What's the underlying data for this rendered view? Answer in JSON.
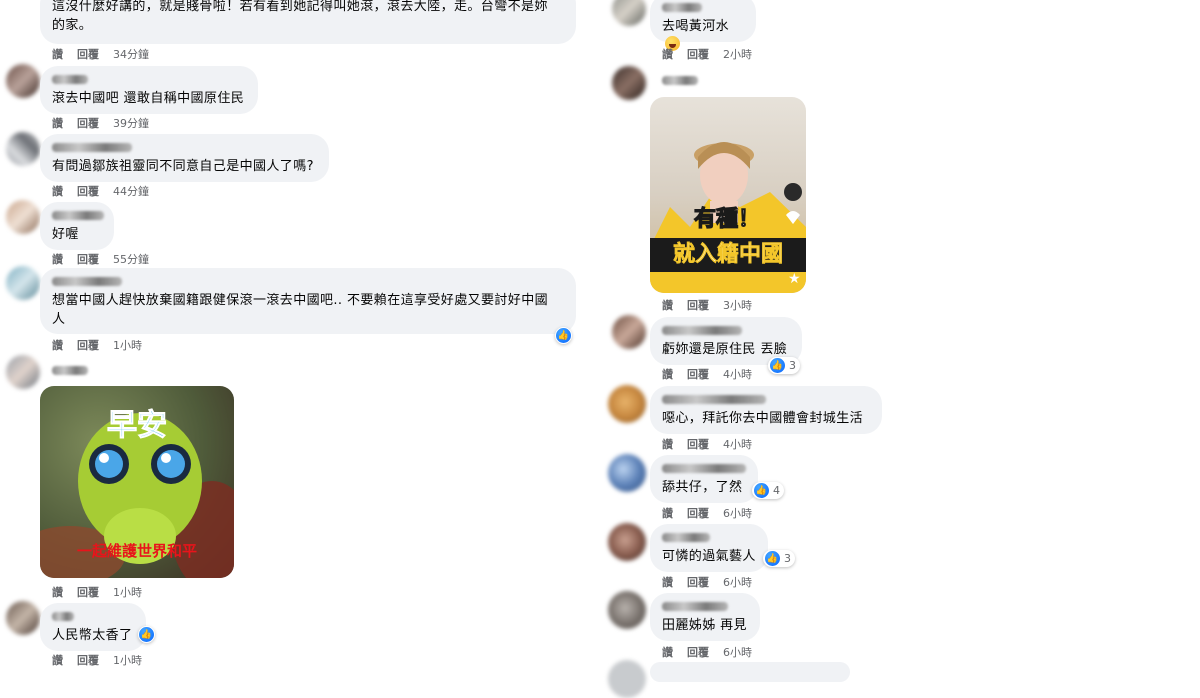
{
  "actions": {
    "like": "讚",
    "reply": "回覆"
  },
  "left": [
    {
      "text": "這沒什麼好講的，就是賤骨啦！若有看到她記得叫她滾，滾去大陸，走。台彎不是妳\n的家。",
      "time": "34分鐘"
    },
    {
      "text": "滾去中國吧 還敢自稱中國原住民",
      "time": "39分鐘"
    },
    {
      "text": "有問過鄒族祖靈同不同意自己是中國人了嗎?",
      "time": "44分鐘"
    },
    {
      "text": "好喔",
      "time": "55分鐘"
    },
    {
      "text": "想當中國人趕快放棄國籍跟健保滾一滾去中國吧.. 不要賴在這享受好處又要討好中國\n人",
      "time": "1小時"
    },
    {
      "time": "1小時",
      "sticker_top": "早安",
      "sticker_bottom": "一起維護世界和平"
    },
    {
      "text": "人民幣太香了",
      "time": "1小時"
    }
  ],
  "right": [
    {
      "text": "去喝黃河水",
      "time": "2小時",
      "emoji": "laughing-emoji"
    },
    {
      "time": "3小時",
      "video_line1": "有種！",
      "video_line2": "就入籍中國"
    },
    {
      "text": "虧妳還是原住民 丟臉",
      "time": "4小時",
      "reactions": "3"
    },
    {
      "text": "噁心，拜託你去中國體會封城生活",
      "time": "4小時"
    },
    {
      "text": "舔共仔，了然",
      "time": "6小時",
      "reactions": "4"
    },
    {
      "text": "可憐的過氣藝人",
      "time": "6小時",
      "reactions": "3"
    },
    {
      "text": "田麗姊姊 再見",
      "time": "6小時"
    }
  ]
}
